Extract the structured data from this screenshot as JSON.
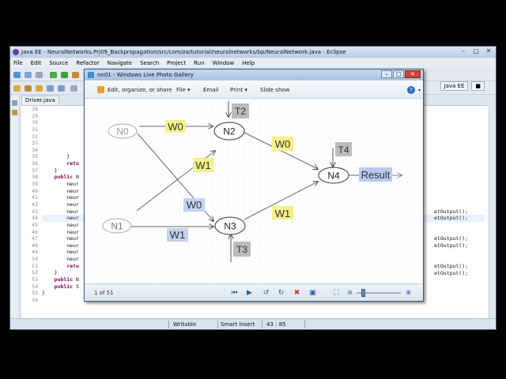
{
  "eclipse": {
    "title": "Java EE - NeuralNetworks.Prj09_Backpropagation/src/com/za/tutorial/neuralnetworks/bp/NeuralNetwork.java - Eclipse",
    "menu": [
      "File",
      "Edit",
      "Source",
      "Refactor",
      "Navigate",
      "Search",
      "Project",
      "Run",
      "Window",
      "Help"
    ],
    "perspective": "Java EE",
    "tab": "Driver.java",
    "line_numbers": [
      "28",
      "29",
      "30",
      "31",
      "32",
      "33",
      "34",
      "35",
      "36",
      "37",
      "38",
      "39",
      "40",
      "41",
      "42",
      "43",
      "44",
      "45",
      "46",
      "47",
      "48",
      "49",
      "50",
      "51",
      "52",
      "53",
      "54",
      "55",
      "56"
    ],
    "code_lines": [
      "",
      "",
      "",
      "",
      "",
      "",
      "",
      "        }",
      "        retu",
      "    }",
      "    public N",
      "        neur",
      "        neur",
      "        neur",
      "        neur",
      "        neur",
      "        neur",
      "        neur",
      "        neur",
      "        neur",
      "        neur",
      "        neur",
      "        neur",
      "        retu",
      "    }",
      "    public N",
      "    public S",
      "}",
      ""
    ],
    "right_code": [
      "etOutput();",
      "etOutput();",
      "etOutput();",
      "etOutput();",
      "etOutput();",
      "etOutput();"
    ],
    "status": {
      "mode": "Writable",
      "insert": "Smart Insert",
      "position": "43 : 85"
    }
  },
  "gallery": {
    "title": "nn01 - Windows Live Photo Gallery",
    "toolbar": {
      "edit": "Edit, organize, or share",
      "file": "File",
      "email": "Email",
      "print": "Print",
      "slideshow": "Slide show",
      "help": "?"
    },
    "counter": "1 of 51"
  },
  "diagram": {
    "nodes": {
      "n0": "N0",
      "n1": "N1",
      "n2": "N2",
      "n3": "N3",
      "n4": "N4"
    },
    "weights": {
      "w0_top": "W0",
      "w1_cross": "W1",
      "w0_cross": "W0",
      "w1_bottom": "W1",
      "w0_out": "W0",
      "w1_out": "W1"
    },
    "thresholds": {
      "t2": "T2",
      "t3": "T3",
      "t4": "T4"
    },
    "result": "Result",
    "colors": {
      "yellow": "#f4f08a",
      "blue": "#c3d2ee",
      "gray_box": "#bcbcbc",
      "result_bg": "#b9c9ef"
    }
  }
}
